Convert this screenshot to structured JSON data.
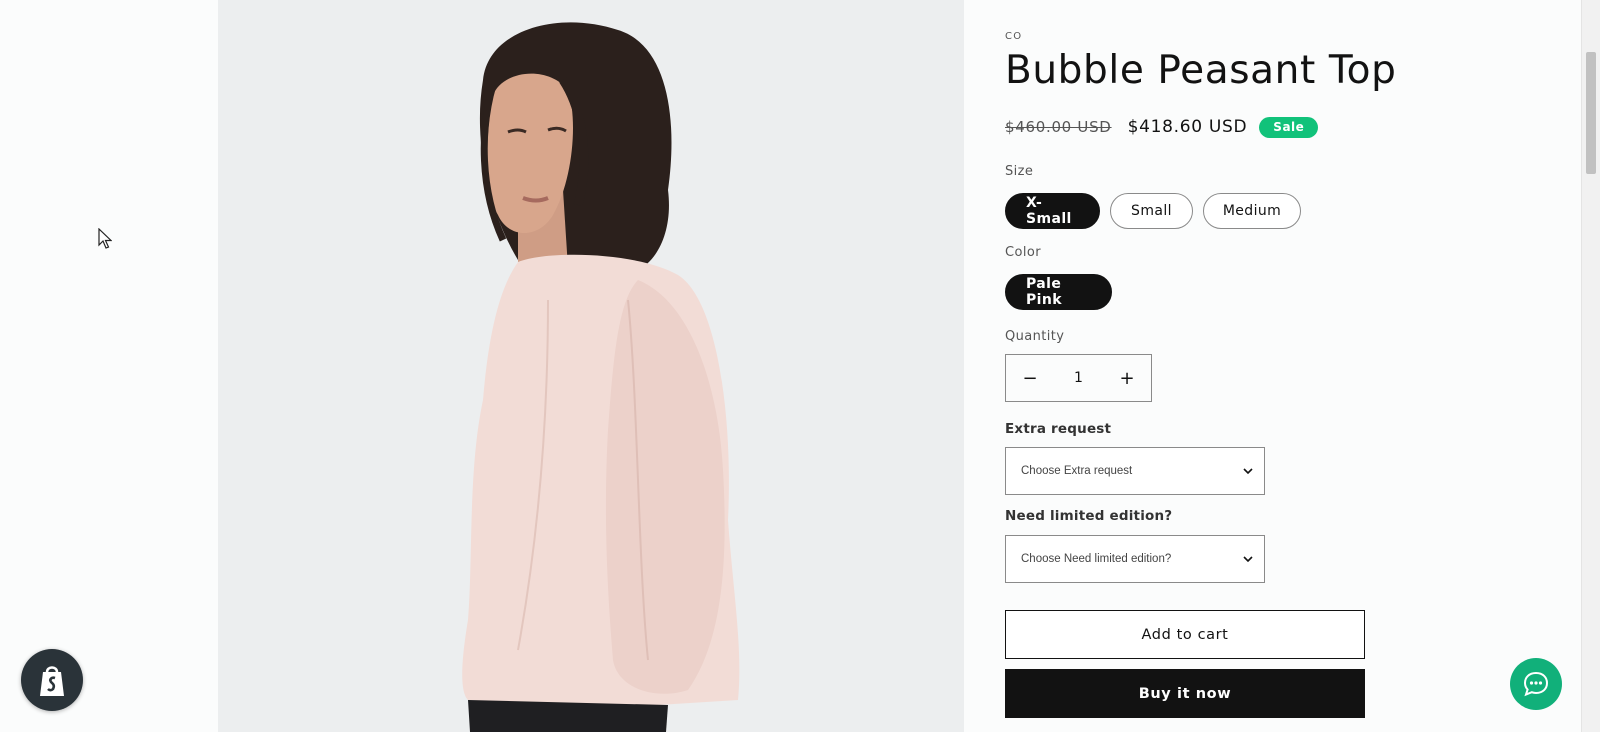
{
  "product": {
    "vendor": "co",
    "title": "Bubble Peasant Top",
    "image_alt": "product-photo",
    "price_regular": "$460.00 USD",
    "price_sale": "$418.60 USD",
    "badge": "Sale"
  },
  "options": {
    "size": {
      "label": "Size",
      "values": [
        "X-Small",
        "Small",
        "Medium"
      ],
      "selected": "X-Small"
    },
    "color": {
      "label": "Color",
      "values": [
        "Pale Pink"
      ],
      "selected": "Pale Pink"
    }
  },
  "quantity": {
    "label": "Quantity",
    "value": "1",
    "minus": "−",
    "plus": "+"
  },
  "extra_request": {
    "label": "Extra request",
    "placeholder": "Choose Extra request"
  },
  "limited_edition": {
    "label": "Need limited edition?",
    "placeholder": "Choose Need limited edition?"
  },
  "actions": {
    "add_to_cart": "Add to cart",
    "buy_now": "Buy it now"
  },
  "colors": {
    "accent": "#121212",
    "sale_badge": "#11c27a",
    "chat": "#11b07a",
    "shopify_fab": "#2a3339"
  },
  "icons": {
    "store": "shopify-bag-icon",
    "chat": "chat-bubble-icon",
    "select": "chevron-down-icon"
  }
}
